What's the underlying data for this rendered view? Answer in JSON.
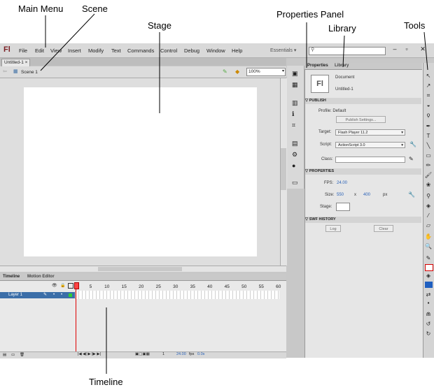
{
  "callouts": {
    "main_menu": "Main Menu",
    "scene": "Scene",
    "stage": "Stage",
    "properties_panel": "Properties Panel",
    "library": "Library",
    "tools": "Tools",
    "timeline": "Timeline"
  },
  "app": {
    "logo": "Fl",
    "menu": [
      "File",
      "Edit",
      "View",
      "Insert",
      "Modify",
      "Text",
      "Commands",
      "Control",
      "Debug",
      "Window",
      "Help"
    ],
    "workspace": "Essentials",
    "document_tab": "Untitled-1",
    "scene": "Scene 1",
    "zoom": "100%"
  },
  "timeline": {
    "tabs": [
      "Timeline",
      "Motion Editor"
    ],
    "ruler": [
      "1",
      "5",
      "10",
      "15",
      "20",
      "25",
      "30",
      "35",
      "40",
      "45",
      "50",
      "55",
      "60"
    ],
    "layer": "Layer 1",
    "fps": "24.00",
    "fps_unit": "fps",
    "time": "0.0s",
    "frame": "1"
  },
  "properties": {
    "tabs": [
      "Properties",
      "Library"
    ],
    "doc_icon": "Fl",
    "doc_type": "Document",
    "doc_name": "Untitled-1",
    "publish": {
      "header": "PUBLISH",
      "profile": "Profile: Default",
      "settings_btn": "Publish Settings...",
      "target_label": "Target:",
      "target": "Flash Player 11.2",
      "script_label": "Script:",
      "script": "ActionScript 3.0",
      "class_label": "Class:"
    },
    "props": {
      "header": "PROPERTIES",
      "fps_label": "FPS:",
      "fps": "24.00",
      "size_label": "Size:",
      "width": "550",
      "x": "x",
      "height": "400",
      "unit": "px",
      "stage_label": "Stage:"
    },
    "swf": {
      "header": "SWF HISTORY",
      "log": "Log",
      "clear": "Clear"
    }
  },
  "colors": {
    "stroke": "#d40000",
    "fill": "#1f5fc0",
    "stage_bg": "#ffffff"
  }
}
